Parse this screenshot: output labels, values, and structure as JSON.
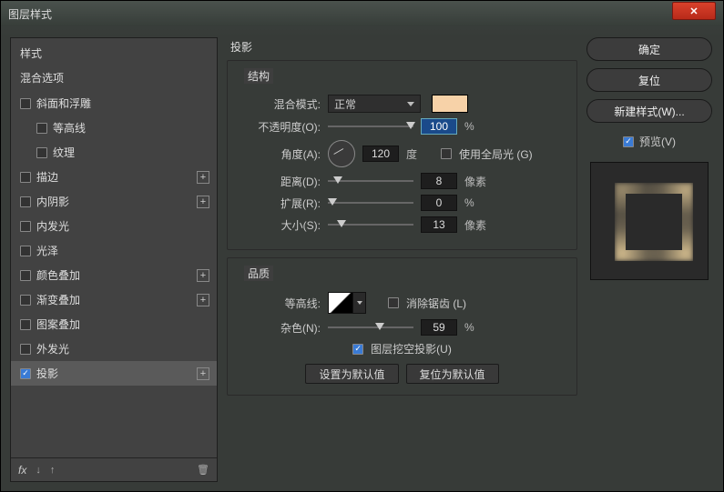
{
  "window": {
    "title": "图层样式"
  },
  "sidebar": {
    "head1": "样式",
    "head2": "混合选项",
    "items": [
      {
        "label": "斜面和浮雕",
        "checked": false,
        "plus": false,
        "indent": false
      },
      {
        "label": "等高线",
        "checked": false,
        "plus": false,
        "indent": true
      },
      {
        "label": "纹理",
        "checked": false,
        "plus": false,
        "indent": true
      },
      {
        "label": "描边",
        "checked": false,
        "plus": true,
        "indent": false
      },
      {
        "label": "内阴影",
        "checked": false,
        "plus": true,
        "indent": false
      },
      {
        "label": "内发光",
        "checked": false,
        "plus": false,
        "indent": false
      },
      {
        "label": "光泽",
        "checked": false,
        "plus": false,
        "indent": false
      },
      {
        "label": "颜色叠加",
        "checked": false,
        "plus": true,
        "indent": false
      },
      {
        "label": "渐变叠加",
        "checked": false,
        "plus": true,
        "indent": false
      },
      {
        "label": "图案叠加",
        "checked": false,
        "plus": false,
        "indent": false
      },
      {
        "label": "外发光",
        "checked": false,
        "plus": false,
        "indent": false
      },
      {
        "label": "投影",
        "checked": true,
        "plus": true,
        "indent": false,
        "active": true
      }
    ],
    "footer": {
      "fx": "fx",
      "down": "↓",
      "up": "↑",
      "trash": "🗑"
    }
  },
  "main": {
    "title": "投影",
    "structure": {
      "title": "结构",
      "blendMode": {
        "label": "混合模式:",
        "value": "正常"
      },
      "opacity": {
        "label": "不透明度(O):",
        "value": "100",
        "unit": "%"
      },
      "angle": {
        "label": "角度(A):",
        "value": "120",
        "unit": "度"
      },
      "globalLight": {
        "label": "使用全局光 (G)",
        "checked": false
      },
      "distance": {
        "label": "距离(D):",
        "value": "8",
        "unit": "像素"
      },
      "spread": {
        "label": "扩展(R):",
        "value": "0",
        "unit": "%"
      },
      "size": {
        "label": "大小(S):",
        "value": "13",
        "unit": "像素"
      }
    },
    "quality": {
      "title": "品质",
      "contour": {
        "label": "等高线:"
      },
      "antialias": {
        "label": "消除锯齿 (L)",
        "checked": false
      },
      "noise": {
        "label": "杂色(N):",
        "value": "59",
        "unit": "%"
      }
    },
    "knockout": {
      "label": "图层挖空投影(U)",
      "checked": true
    },
    "buttons": {
      "default": "设置为默认值",
      "reset": "复位为默认值"
    }
  },
  "right": {
    "ok": "确定",
    "cancel": "复位",
    "newStyle": "新建样式(W)...",
    "preview": {
      "label": "预览(V)",
      "checked": true
    }
  }
}
